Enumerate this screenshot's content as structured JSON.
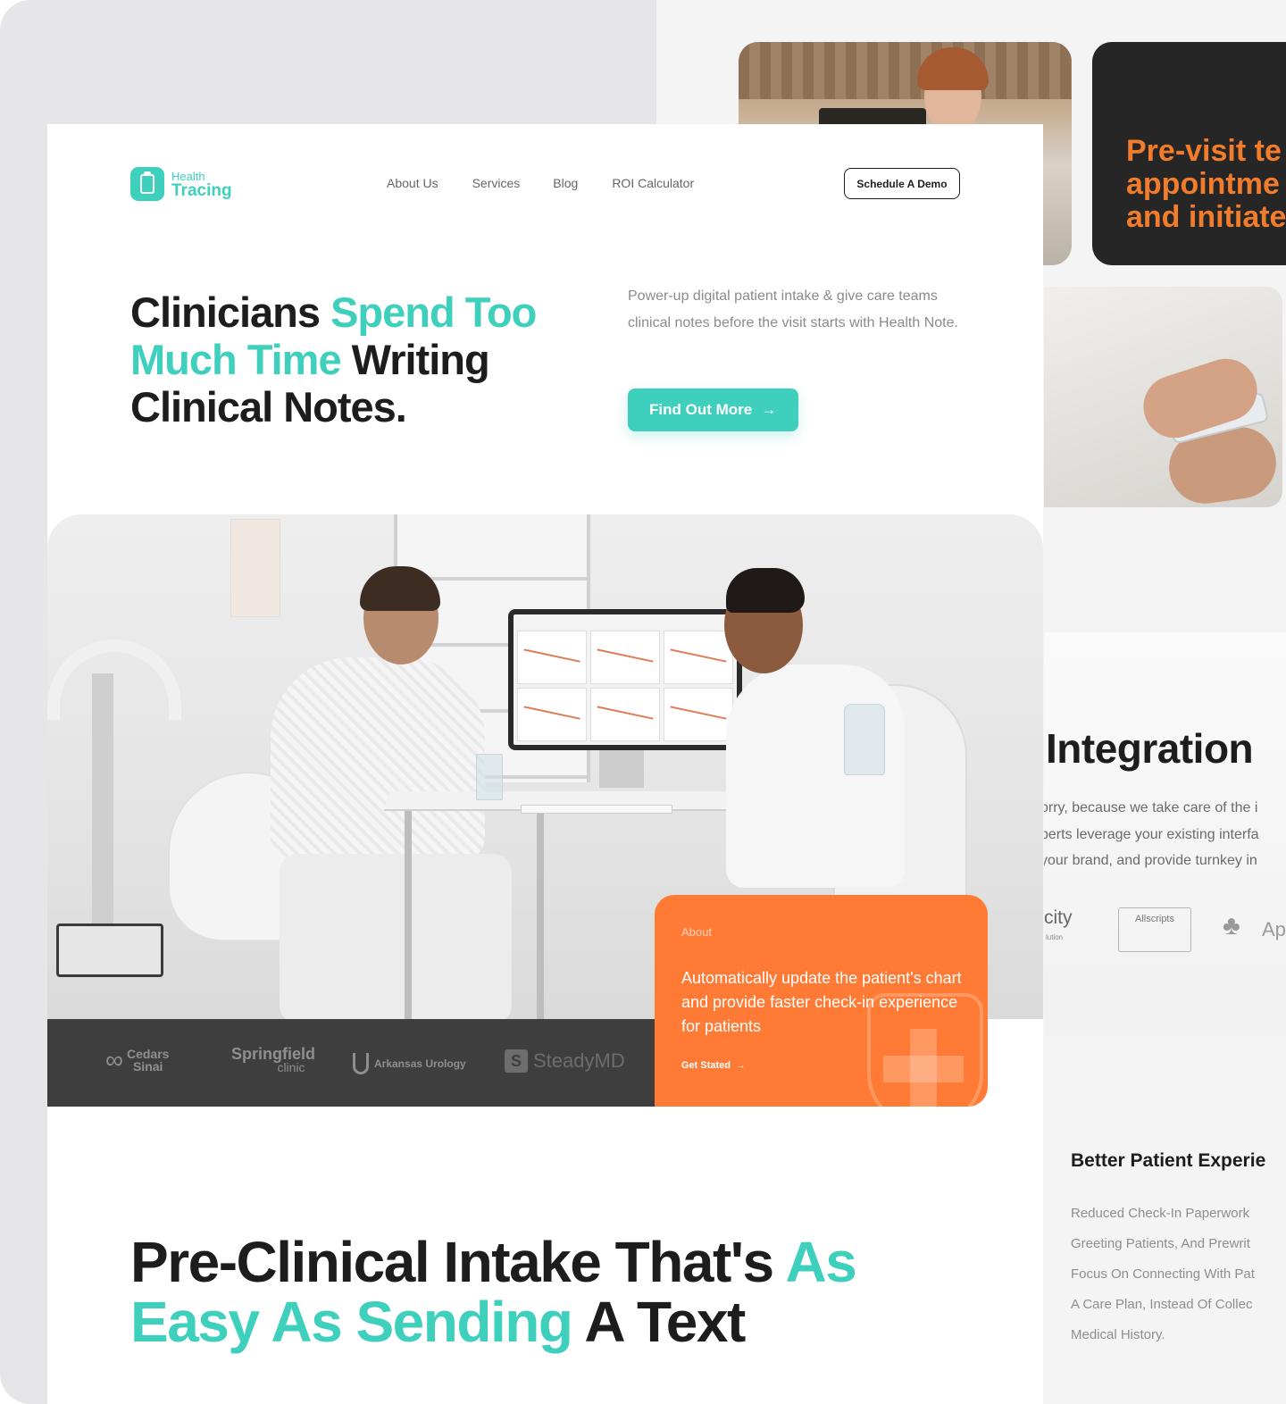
{
  "colors": {
    "teal": "#3fcfbd",
    "orange": "#ff7b35",
    "dark": "#1d1d1d",
    "charcoal": "#3e3e3e"
  },
  "nav": {
    "logo_small": "Health",
    "logo_big": "Tracing",
    "links": [
      "About Us",
      "Services",
      "Blog",
      "ROI Calculator"
    ],
    "cta": "Schedule A Demo"
  },
  "hero": {
    "title_part1": "Clinicians ",
    "title_part2": "Spend Too Much Time",
    "title_part3": " Writing Clinical Notes.",
    "description": "Power-up digital patient intake & give care teams clinical notes before the visit starts with Health Note.",
    "cta_label": "Find Out More",
    "cta_icon": "arrow-right-icon"
  },
  "partners": {
    "cedars_line1": "Cedars",
    "cedars_line2": "Sinai",
    "springfield": "Springfield",
    "springfield_sub": "clinic",
    "arkansas": "Arkansas Urology",
    "steady": "SteadyMD"
  },
  "about_card": {
    "label": "About",
    "text": "Automatically update the patient's chart and provide faster check-in experience for patients",
    "link": "Get Stated"
  },
  "intake": {
    "part1": "Pre-Clinical Intake That's ",
    "part2": "As Easy As Sending",
    "part3": " A Text"
  },
  "right_page": {
    "dark_card_text": [
      "Pre-visit te",
      "appointme",
      "and initiate"
    ],
    "integration_title": "Integration",
    "integration_lines": [
      "orry, because we take care of the i",
      "perts leverage your existing interfa",
      "your brand, and provide turnkey in"
    ],
    "logo_city": "city",
    "logo_city_sub": "lution",
    "logo_allscripts": "Allscripts",
    "logo_ap": "Ap",
    "better_title": "Better Patient Experie",
    "better_items": [
      "Reduced Check-In Paperwork",
      "Greeting Patients, And Prewrit",
      "Focus On Connecting With Pat",
      "A Care Plan, Instead Of Collec",
      "Medical History."
    ]
  }
}
